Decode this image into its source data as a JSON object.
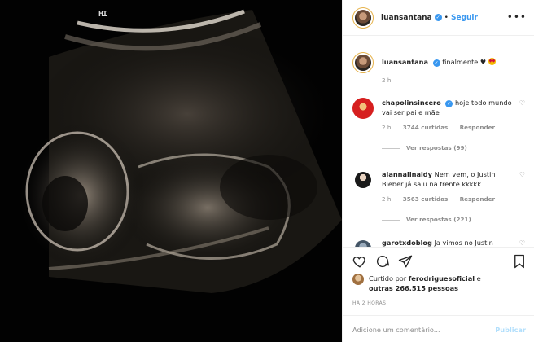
{
  "photo": {
    "corner_mark": "HI"
  },
  "header": {
    "username": "luansantana",
    "separator": "•",
    "follow_label": "Seguir",
    "more_label": "•••"
  },
  "caption": {
    "username": "luansantana",
    "text": "finalmente ♥",
    "time": "2 h"
  },
  "comments": [
    {
      "username": "chapolinsincero",
      "verified": true,
      "text": "hoje todo mundo vai ser pai e mãe",
      "time": "2 h",
      "likes": "3744 curtidas",
      "reply_label": "Responder",
      "replies": "Ver respostas (99)"
    },
    {
      "username": "alannalinaldy",
      "verified": false,
      "text": "Nem vem, o Justin Bieber já saiu na frente kkkkk",
      "time": "2 h",
      "likes": "3563 curtidas",
      "reply_label": "Responder",
      "replies": "Ver respostas (221)"
    },
    {
      "username": "garotxdoblog",
      "verified": false,
      "text": "Ja vimos no Justin"
    }
  ],
  "actions": {
    "liked_prefix": "Curtido por",
    "liked_user": "ferodriguesoficial",
    "liked_and": "e",
    "liked_others": "outras 266.515 pessoas",
    "time_ago": "Há 2 horas",
    "comment_placeholder": "Adicione um comentário...",
    "publish_label": "Publicar"
  },
  "icons": [
    "heart-icon",
    "comment-icon",
    "share-icon",
    "bookmark-icon",
    "more-icon",
    "verified-icon"
  ],
  "colors": {
    "link_blue": "#3897f0",
    "publish_disabled": "#b2dffc",
    "muted_text": "#8e8e8e",
    "photo_bg": "#020202"
  }
}
